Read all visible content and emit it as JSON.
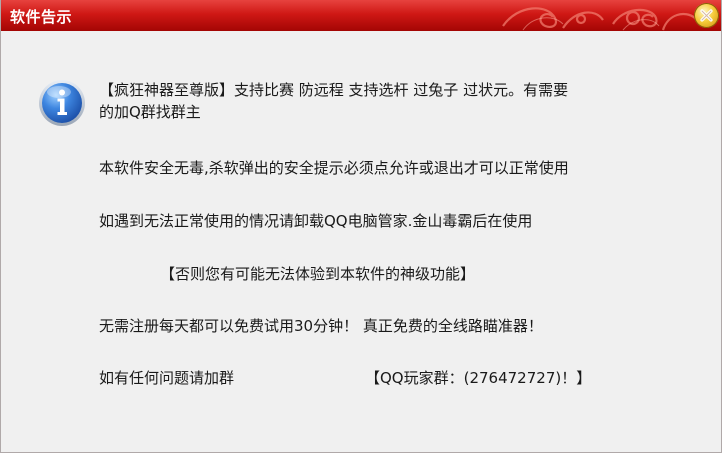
{
  "window": {
    "title": "软件告示"
  },
  "message": {
    "line1a": "【疯狂神器至尊版】支持比赛 防远程 支持选杆 过兔子 过状元。有需要",
    "line1b": "的加Q群找群主",
    "line2": "本软件安全无毒,杀软弹出的安全提示必须点允许或退出才可以正常使用",
    "line3": "如遇到无法正常使用的情况请卸载QQ电脑管家.金山毒霸后在使用",
    "line4": "【否则您有可能无法体验到本软件的神级功能】",
    "line5": "无需注册每天都可以免费试用30分钟！ 真正免费的全线路瞄准器！",
    "line6_left": "如有任何问题请加群",
    "line6_right": "【QQ玩家群：(276472727)！】"
  },
  "icons": {
    "info": "info-icon",
    "close": "close-icon"
  },
  "colors": {
    "titlebar": "#cf1815",
    "close_button": "#f6cb3a",
    "info_icon": "#2f6fcf"
  }
}
